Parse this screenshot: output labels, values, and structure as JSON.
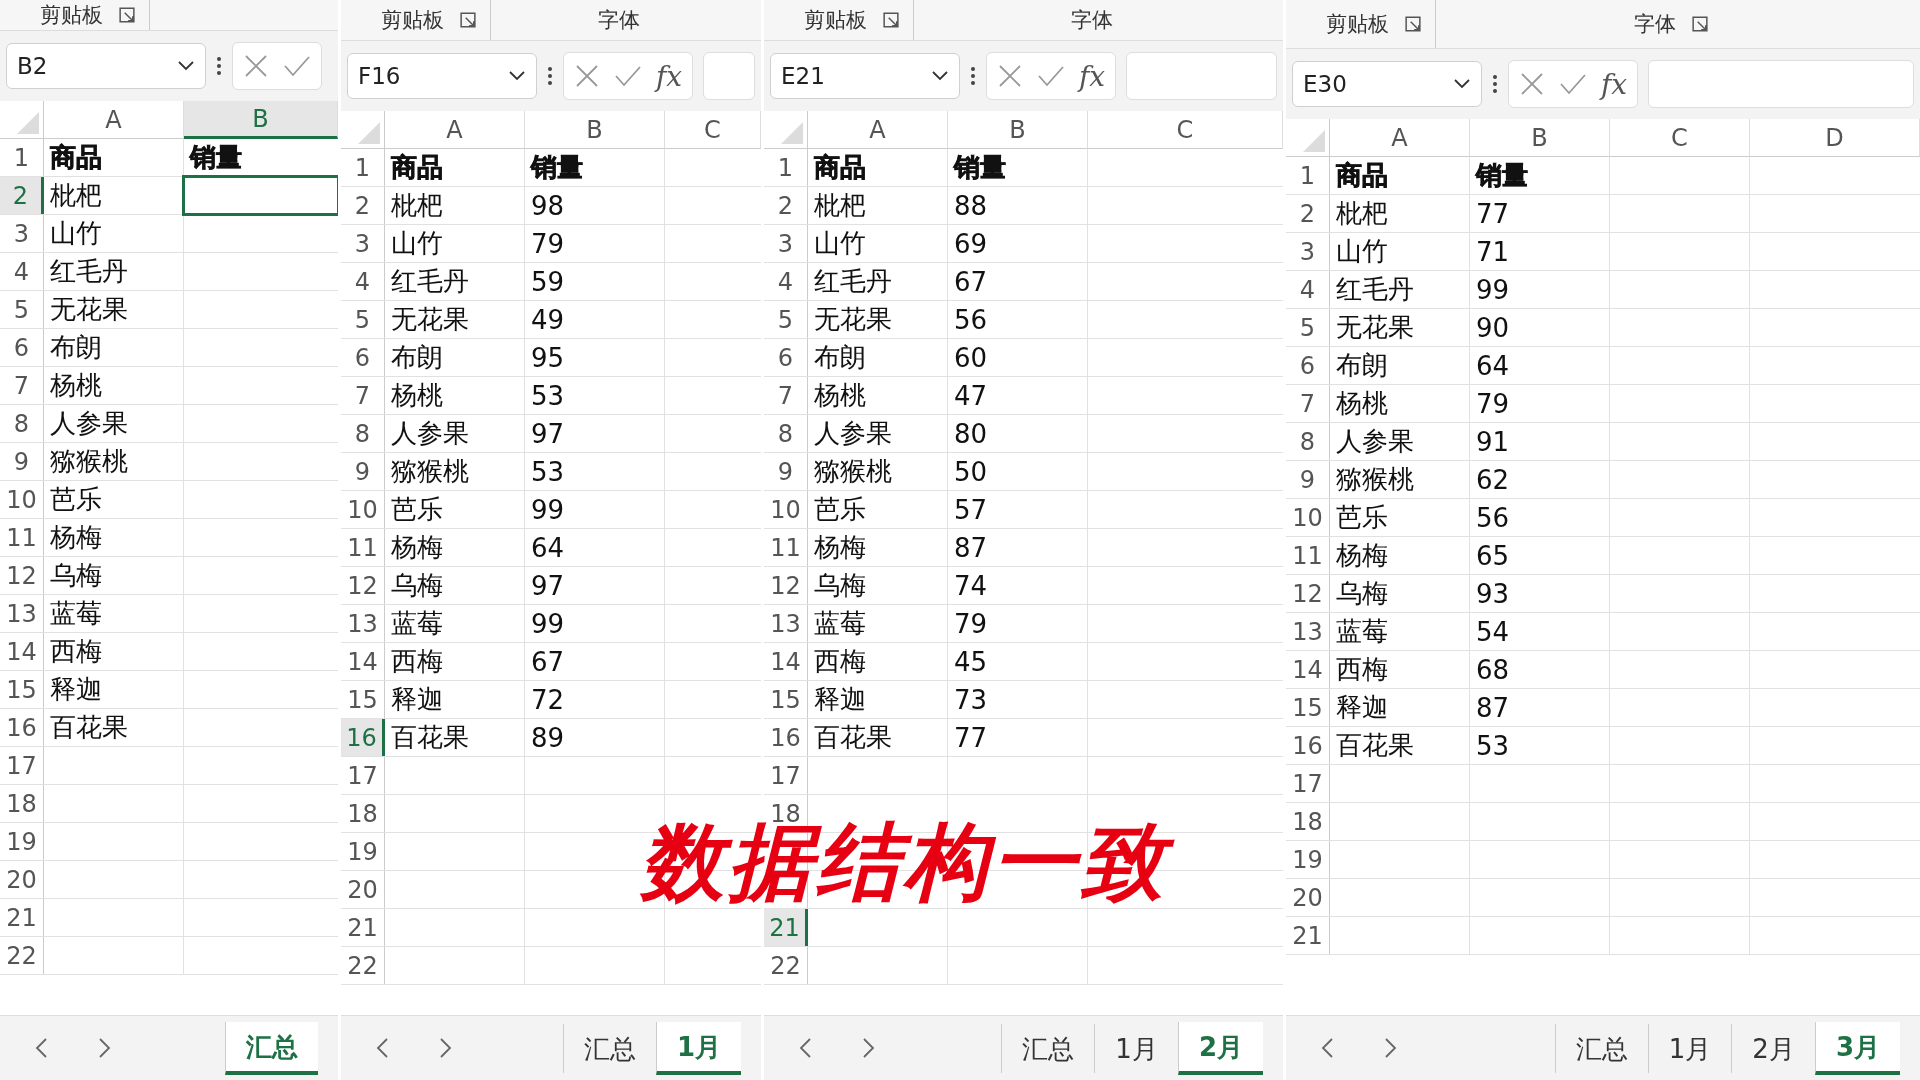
{
  "panels": [
    {
      "ribbon": {
        "groups": [
          {
            "label": "剪贴板",
            "launcher": true
          }
        ]
      },
      "name_box": "B2",
      "columns": [
        {
          "label": "A",
          "selected": false
        },
        {
          "label": "B",
          "selected": true
        }
      ],
      "rows": [
        {
          "number": "1",
          "selected": false,
          "cells": [
            "商品",
            "销量"
          ]
        },
        {
          "number": "2",
          "selected": true,
          "cells": [
            "枇杷"
          ]
        },
        {
          "number": "3",
          "selected": false,
          "cells": [
            "山竹"
          ]
        },
        {
          "number": "4",
          "selected": false,
          "cells": [
            "红毛丹"
          ]
        },
        {
          "number": "5",
          "selected": false,
          "cells": [
            "无花果"
          ]
        },
        {
          "number": "6",
          "selected": false,
          "cells": [
            "布朗"
          ]
        },
        {
          "number": "7",
          "selected": false,
          "cells": [
            "杨桃"
          ]
        },
        {
          "number": "8",
          "selected": false,
          "cells": [
            "人参果"
          ]
        },
        {
          "number": "9",
          "selected": false,
          "cells": [
            "猕猴桃"
          ]
        },
        {
          "number": "10",
          "selected": false,
          "cells": [
            "芭乐"
          ]
        },
        {
          "number": "11",
          "selected": false,
          "cells": [
            "杨梅"
          ]
        },
        {
          "number": "12",
          "selected": false,
          "cells": [
            "乌梅"
          ]
        },
        {
          "number": "13",
          "selected": false,
          "cells": [
            "蓝莓"
          ]
        },
        {
          "number": "14",
          "selected": false,
          "cells": [
            "西梅"
          ]
        },
        {
          "number": "15",
          "selected": false,
          "cells": [
            "释迦"
          ]
        },
        {
          "number": "16",
          "selected": false,
          "cells": [
            "百花果"
          ]
        },
        {
          "number": "17",
          "selected": false,
          "cells": []
        },
        {
          "number": "18",
          "selected": false,
          "cells": []
        },
        {
          "number": "19",
          "selected": false,
          "cells": []
        },
        {
          "number": "20",
          "selected": false,
          "cells": []
        },
        {
          "number": "21",
          "selected": false,
          "cells": []
        },
        {
          "number": "22",
          "selected": false,
          "cells": []
        }
      ],
      "sheet_tabs": [
        {
          "label": "汇总",
          "selected": true
        }
      ]
    },
    {
      "ribbon": {
        "groups": [
          {
            "label": "剪贴板",
            "launcher": true
          },
          {
            "label": "字体",
            "launcher": false
          }
        ]
      },
      "name_box": "F16",
      "fx": "fx",
      "columns": [
        {
          "label": "A",
          "selected": false
        },
        {
          "label": "B",
          "selected": false
        },
        {
          "label": "C",
          "selected": false
        }
      ],
      "rows": [
        {
          "number": "1",
          "selected": false,
          "cells": [
            "商品",
            "销量"
          ]
        },
        {
          "number": "2",
          "selected": false,
          "cells": [
            "枇杷",
            "98"
          ]
        },
        {
          "number": "3",
          "selected": false,
          "cells": [
            "山竹",
            "79"
          ]
        },
        {
          "number": "4",
          "selected": false,
          "cells": [
            "红毛丹",
            "59"
          ]
        },
        {
          "number": "5",
          "selected": false,
          "cells": [
            "无花果",
            "49"
          ]
        },
        {
          "number": "6",
          "selected": false,
          "cells": [
            "布朗",
            "95"
          ]
        },
        {
          "number": "7",
          "selected": false,
          "cells": [
            "杨桃",
            "53"
          ]
        },
        {
          "number": "8",
          "selected": false,
          "cells": [
            "人参果",
            "97"
          ]
        },
        {
          "number": "9",
          "selected": false,
          "cells": [
            "猕猴桃",
            "53"
          ]
        },
        {
          "number": "10",
          "selected": false,
          "cells": [
            "芭乐",
            "99"
          ]
        },
        {
          "number": "11",
          "selected": false,
          "cells": [
            "杨梅",
            "64"
          ]
        },
        {
          "number": "12",
          "selected": false,
          "cells": [
            "乌梅",
            "97"
          ]
        },
        {
          "number": "13",
          "selected": false,
          "cells": [
            "蓝莓",
            "99"
          ]
        },
        {
          "number": "14",
          "selected": false,
          "cells": [
            "西梅",
            "67"
          ]
        },
        {
          "number": "15",
          "selected": false,
          "cells": [
            "释迦",
            "72"
          ]
        },
        {
          "number": "16",
          "selected": true,
          "cells": [
            "百花果",
            "89"
          ]
        },
        {
          "number": "17",
          "selected": false,
          "cells": []
        },
        {
          "number": "18",
          "selected": false,
          "cells": []
        },
        {
          "number": "19",
          "selected": false,
          "cells": []
        },
        {
          "number": "20",
          "selected": false,
          "cells": []
        },
        {
          "number": "21",
          "selected": false,
          "cells": []
        },
        {
          "number": "22",
          "selected": false,
          "cells": []
        }
      ],
      "sheet_tabs": [
        {
          "label": "汇总",
          "selected": false
        },
        {
          "label": "1月",
          "selected": true
        }
      ]
    },
    {
      "ribbon": {
        "groups": [
          {
            "label": "剪贴板",
            "launcher": true
          },
          {
            "label": "字体",
            "launcher": false
          }
        ]
      },
      "name_box": "E21",
      "fx": "fx",
      "columns": [
        {
          "label": "A",
          "selected": false
        },
        {
          "label": "B",
          "selected": false
        },
        {
          "label": "C",
          "selected": false
        }
      ],
      "rows": [
        {
          "number": "1",
          "selected": false,
          "cells": [
            "商品",
            "销量"
          ]
        },
        {
          "number": "2",
          "selected": false,
          "cells": [
            "枇杷",
            "88"
          ]
        },
        {
          "number": "3",
          "selected": false,
          "cells": [
            "山竹",
            "69"
          ]
        },
        {
          "number": "4",
          "selected": false,
          "cells": [
            "红毛丹",
            "67"
          ]
        },
        {
          "number": "5",
          "selected": false,
          "cells": [
            "无花果",
            "56"
          ]
        },
        {
          "number": "6",
          "selected": false,
          "cells": [
            "布朗",
            "60"
          ]
        },
        {
          "number": "7",
          "selected": false,
          "cells": [
            "杨桃",
            "47"
          ]
        },
        {
          "number": "8",
          "selected": false,
          "cells": [
            "人参果",
            "80"
          ]
        },
        {
          "number": "9",
          "selected": false,
          "cells": [
            "猕猴桃",
            "50"
          ]
        },
        {
          "number": "10",
          "selected": false,
          "cells": [
            "芭乐",
            "57"
          ]
        },
        {
          "number": "11",
          "selected": false,
          "cells": [
            "杨梅",
            "87"
          ]
        },
        {
          "number": "12",
          "selected": false,
          "cells": [
            "乌梅",
            "74"
          ]
        },
        {
          "number": "13",
          "selected": false,
          "cells": [
            "蓝莓",
            "79"
          ]
        },
        {
          "number": "14",
          "selected": false,
          "cells": [
            "西梅",
            "45"
          ]
        },
        {
          "number": "15",
          "selected": false,
          "cells": [
            "释迦",
            "73"
          ]
        },
        {
          "number": "16",
          "selected": false,
          "cells": [
            "百花果",
            "77"
          ]
        },
        {
          "number": "17",
          "selected": false,
          "cells": []
        },
        {
          "number": "18",
          "selected": false,
          "cells": []
        },
        {},
        {},
        {
          "number": "21",
          "selected": true,
          "cells": []
        },
        {
          "number": "22",
          "selected": false,
          "cells": []
        }
      ],
      "sheet_tabs": [
        {
          "label": "汇总",
          "selected": false
        },
        {
          "label": "1月",
          "selected": false
        },
        {
          "label": "2月",
          "selected": true
        }
      ]
    },
    {
      "ribbon": {
        "groups": [
          {
            "label": "剪贴板",
            "launcher": true
          },
          {
            "label": "字体",
            "launcher": true
          }
        ]
      },
      "name_box": "E30",
      "fx": "fx",
      "columns": [
        {
          "label": "A",
          "selected": false
        },
        {
          "label": "B",
          "selected": false
        },
        {
          "label": "C",
          "selected": false
        },
        {
          "label": "D",
          "selected": false
        }
      ],
      "rows": [
        {
          "number": "1",
          "selected": false,
          "cells": [
            "商品",
            "销量"
          ]
        },
        {
          "number": "2",
          "selected": false,
          "cells": [
            "枇杷",
            "77"
          ]
        },
        {
          "number": "3",
          "selected": false,
          "cells": [
            "山竹",
            "71"
          ]
        },
        {
          "number": "4",
          "selected": false,
          "cells": [
            "红毛丹",
            "99"
          ]
        },
        {
          "number": "5",
          "selected": false,
          "cells": [
            "无花果",
            "90"
          ]
        },
        {
          "number": "6",
          "selected": false,
          "cells": [
            "布朗",
            "64"
          ]
        },
        {
          "number": "7",
          "selected": false,
          "cells": [
            "杨桃",
            "79"
          ]
        },
        {
          "number": "8",
          "selected": false,
          "cells": [
            "人参果",
            "91"
          ]
        },
        {
          "number": "9",
          "selected": false,
          "cells": [
            "猕猴桃",
            "62"
          ]
        },
        {
          "number": "10",
          "selected": false,
          "cells": [
            "芭乐",
            "56"
          ]
        },
        {
          "number": "11",
          "selected": false,
          "cells": [
            "杨梅",
            "65"
          ]
        },
        {
          "number": "12",
          "selected": false,
          "cells": [
            "乌梅",
            "93"
          ]
        },
        {
          "number": "13",
          "selected": false,
          "cells": [
            "蓝莓",
            "54"
          ]
        },
        {
          "number": "14",
          "selected": false,
          "cells": [
            "西梅",
            "68"
          ]
        },
        {
          "number": "15",
          "selected": false,
          "cells": [
            "释迦",
            "87"
          ]
        },
        {
          "number": "16",
          "selected": false,
          "cells": [
            "百花果",
            "53"
          ]
        },
        {
          "number": "17",
          "selected": false,
          "cells": []
        },
        {
          "number": "18",
          "selected": false,
          "cells": []
        },
        {
          "number": "19",
          "selected": false,
          "cells": []
        },
        {
          "number": "20",
          "selected": false,
          "cells": []
        },
        {
          "number": "21",
          "selected": false,
          "cells": []
        }
      ],
      "sheet_tabs": [
        {
          "label": "汇总",
          "selected": false
        },
        {
          "label": "1月",
          "selected": false
        },
        {
          "label": "2月",
          "selected": false
        },
        {
          "label": "3月",
          "selected": true
        }
      ]
    }
  ],
  "caption": "数据结构一致"
}
